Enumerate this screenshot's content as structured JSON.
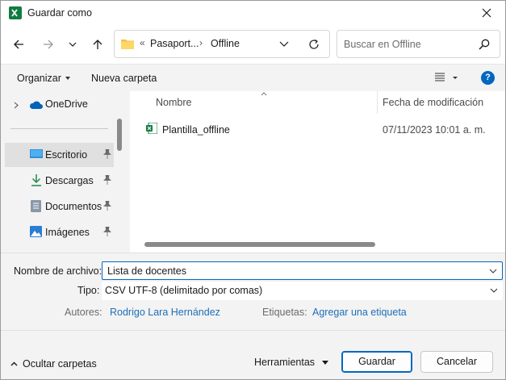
{
  "window": {
    "title": "Guardar como",
    "app_icon": "excel-icon"
  },
  "nav": {
    "breadcrumb": [
      "«",
      "Pasaport...",
      "Offline"
    ],
    "search_placeholder": "Buscar en Offline"
  },
  "toolbar": {
    "organize": "Organizar",
    "new_folder": "Nueva carpeta"
  },
  "sidebar": {
    "items": [
      {
        "label": "OneDrive",
        "icon": "cloud-icon"
      },
      {
        "label": "Escritorio",
        "icon": "desktop-icon",
        "selected": true
      },
      {
        "label": "Descargas",
        "icon": "download-icon"
      },
      {
        "label": "Documentos",
        "icon": "document-icon"
      },
      {
        "label": "Imágenes",
        "icon": "image-icon"
      }
    ]
  },
  "filelist": {
    "columns": [
      "Nombre",
      "Fecha de modificación"
    ],
    "rows": [
      {
        "name": "Plantilla_offline",
        "date": "07/11/2023 10:01 a. m."
      }
    ]
  },
  "form": {
    "filename_label": "Nombre de archivo:",
    "filename_value": "Lista de docentes",
    "type_label": "Tipo:",
    "type_value": "CSV UTF-8 (delimitado por comas)",
    "authors_label": "Autores:",
    "authors_value": "Rodrigo Lara Hernández",
    "tags_label": "Etiquetas:",
    "tags_value": "Agregar una etiqueta"
  },
  "footer": {
    "hide_folders": "Ocultar carpetas",
    "tools": "Herramientas",
    "save": "Guardar",
    "cancel": "Cancelar"
  },
  "colors": {
    "accent": "#0067c0",
    "link": "#1d6fb8",
    "excel_green": "#107c41"
  }
}
